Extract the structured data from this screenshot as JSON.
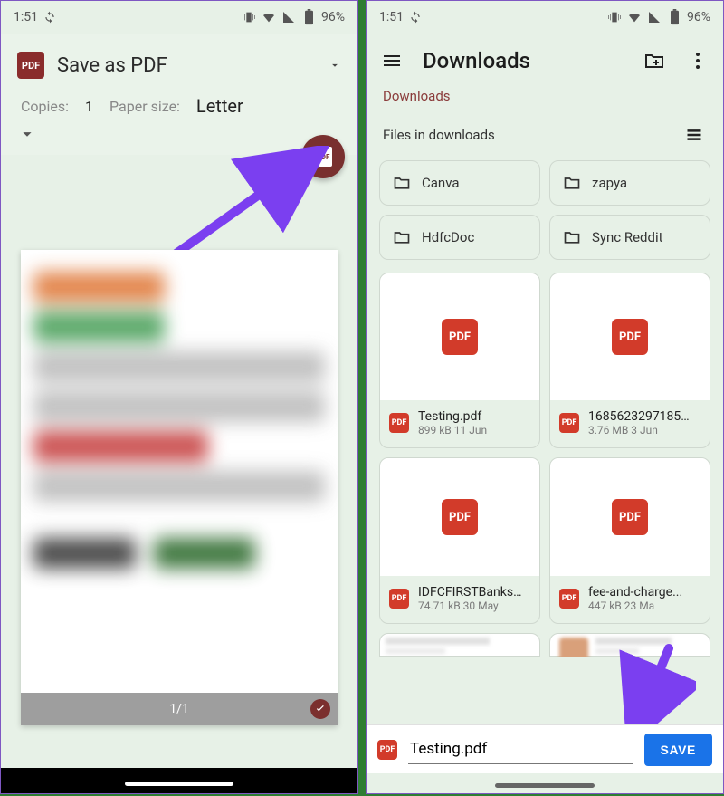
{
  "status": {
    "time": "1:51",
    "battery": "96%"
  },
  "left": {
    "title": "Save as PDF",
    "copies_label": "Copies:",
    "copies_value": "1",
    "papersize_label": "Paper size:",
    "papersize_value": "Letter",
    "page_indicator": "1/1",
    "pdf_badge": "PDF"
  },
  "right": {
    "title": "Downloads",
    "breadcrumb": "Downloads",
    "section_label": "Files in downloads",
    "folders": [
      {
        "name": "Canva"
      },
      {
        "name": "zapya"
      },
      {
        "name": "HdfcDoc"
      },
      {
        "name": "Sync Reddit"
      }
    ],
    "files": [
      {
        "name": "Testing.pdf",
        "meta": "899 kB 11 Jun"
      },
      {
        "name": "1685623297185j...",
        "meta": "3.76 MB 3 Jun"
      },
      {
        "name": "IDFCFIRSTBanks...",
        "meta": "74.71 kB 30 May"
      },
      {
        "name": "fee-and-charge...",
        "meta": "447 kB 23 Ma"
      }
    ],
    "filename_value": "Testing.pdf",
    "save_label": "SAVE",
    "pdf_badge": "PDF"
  }
}
